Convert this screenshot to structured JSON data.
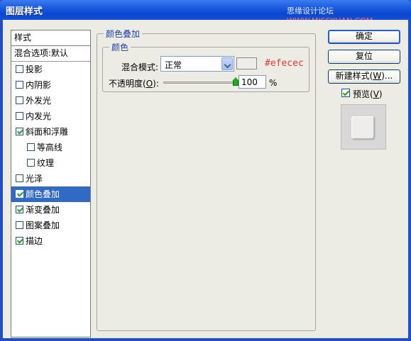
{
  "window": {
    "title": "图层样式",
    "watermark": "思缘设计论坛",
    "watermark_url": "WWW.MISSYUAN.COM"
  },
  "styles_list": {
    "header": "样式",
    "blend_options": "混合选项:默认",
    "effects": [
      {
        "label": "投影",
        "checked": false,
        "indent": 0,
        "selected": false
      },
      {
        "label": "内阴影",
        "checked": false,
        "indent": 0,
        "selected": false
      },
      {
        "label": "外发光",
        "checked": false,
        "indent": 0,
        "selected": false
      },
      {
        "label": "内发光",
        "checked": false,
        "indent": 0,
        "selected": false
      },
      {
        "label": "斜面和浮雕",
        "checked": true,
        "indent": 0,
        "selected": false
      },
      {
        "label": "等高线",
        "checked": false,
        "indent": 1,
        "selected": false
      },
      {
        "label": "纹理",
        "checked": false,
        "indent": 1,
        "selected": false
      },
      {
        "label": "光泽",
        "checked": false,
        "indent": 0,
        "selected": false
      },
      {
        "label": "颜色叠加",
        "checked": true,
        "indent": 0,
        "selected": true
      },
      {
        "label": "渐变叠加",
        "checked": true,
        "indent": 0,
        "selected": false
      },
      {
        "label": "图案叠加",
        "checked": false,
        "indent": 0,
        "selected": false
      },
      {
        "label": "描边",
        "checked": true,
        "indent": 0,
        "selected": false
      }
    ]
  },
  "color_overlay": {
    "group_title": "颜色叠加",
    "sub_title": "颜色",
    "blend_mode_label": "混合模式:",
    "blend_mode_value": "正常",
    "color_hex": "#efecec",
    "color_annotation": "#efecec",
    "opacity_label_pre": "不透明度(",
    "opacity_label_key": "O",
    "opacity_label_post": "):",
    "opacity_value": "100",
    "opacity_fraction": 1.0,
    "opacity_unit": "%"
  },
  "buttons": {
    "ok": "确定",
    "reset": "复位",
    "new_style_pre": "新建样式(",
    "new_style_key": "W",
    "new_style_post": ")..."
  },
  "preview": {
    "label_pre": "预览(",
    "label_key": "V",
    "label_post": ")",
    "checked": true
  },
  "colors": {
    "title_bar": "#0a46d0",
    "selection": "#316ac5",
    "annotation": "#e53935",
    "slider_thumb": "#1fae1f"
  }
}
